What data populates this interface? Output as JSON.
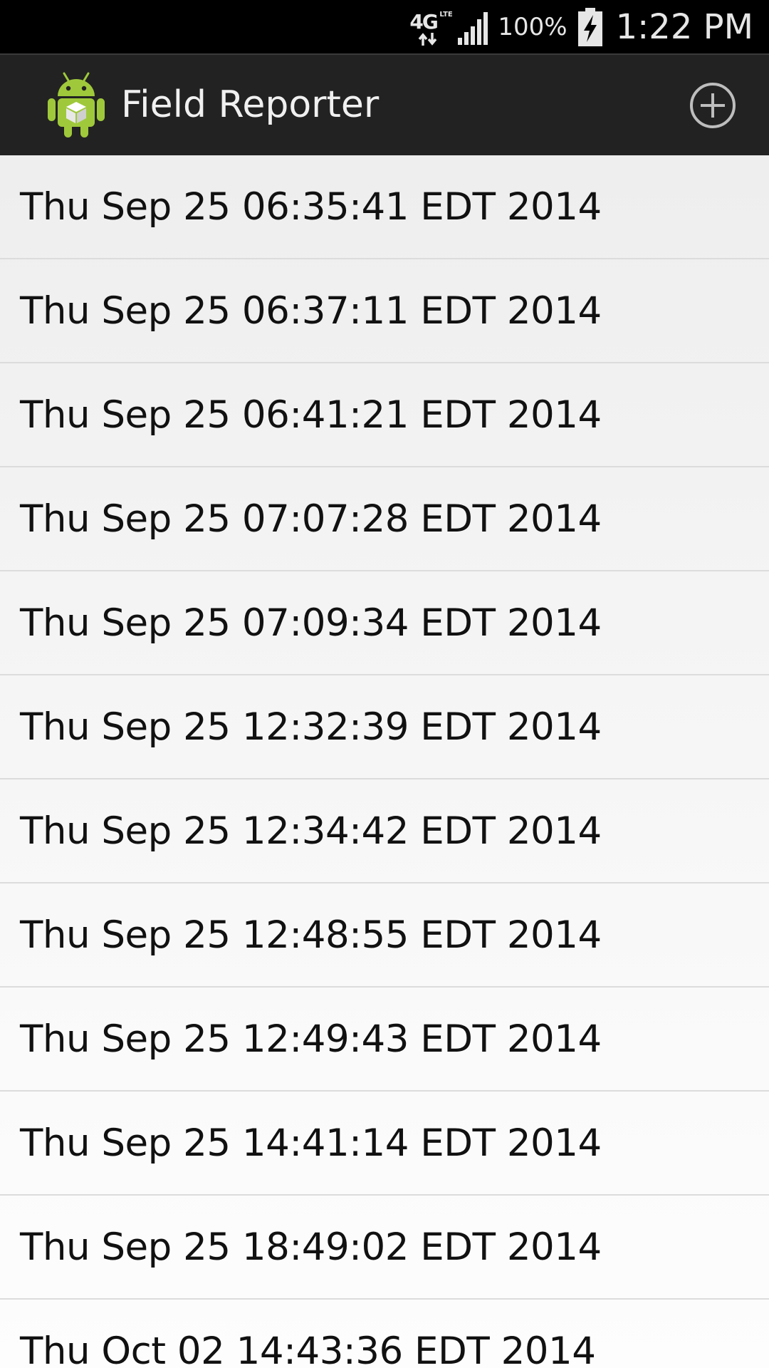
{
  "status_bar": {
    "network": "4G",
    "network_sub": "LTE",
    "battery": "100%",
    "time": "1:22 PM",
    "icons": [
      "4g-lte-icon",
      "signal-bars-icon",
      "battery-charging-icon"
    ]
  },
  "action_bar": {
    "title": "Field Reporter",
    "app_icon": "android-robot-icon",
    "add_icon": "add-circle-icon"
  },
  "reports": [
    {
      "label": "Thu Sep 25 06:35:41 EDT 2014"
    },
    {
      "label": "Thu Sep 25 06:37:11 EDT 2014"
    },
    {
      "label": "Thu Sep 25 06:41:21 EDT 2014"
    },
    {
      "label": "Thu Sep 25 07:07:28 EDT 2014"
    },
    {
      "label": "Thu Sep 25 07:09:34 EDT 2014"
    },
    {
      "label": "Thu Sep 25 12:32:39 EDT 2014"
    },
    {
      "label": "Thu Sep 25 12:34:42 EDT 2014"
    },
    {
      "label": "Thu Sep 25 12:48:55 EDT 2014"
    },
    {
      "label": "Thu Sep 25 12:49:43 EDT 2014"
    },
    {
      "label": "Thu Sep 25 14:41:14 EDT 2014"
    },
    {
      "label": "Thu Sep 25 18:49:02 EDT 2014"
    },
    {
      "label": "Thu Oct 02 14:43:36 EDT 2014"
    }
  ],
  "colors": {
    "status_bar_bg": "#000000",
    "action_bar_bg": "#222222",
    "list_bg": "#f2f2f2",
    "android_green": "#9fc93b"
  }
}
